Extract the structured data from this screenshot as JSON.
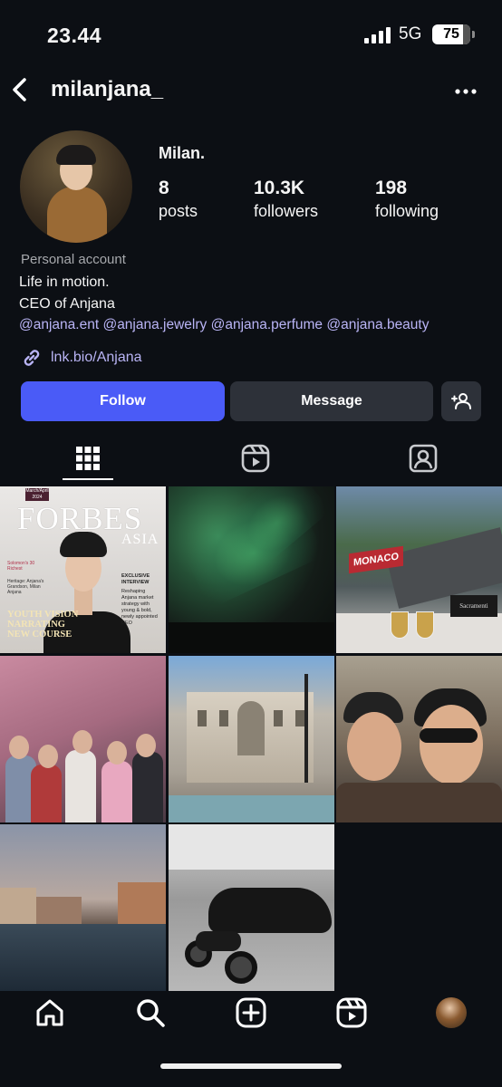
{
  "status_bar": {
    "time": "23.44",
    "network": "5G",
    "battery": "75"
  },
  "header": {
    "username": "milanjana_"
  },
  "profile": {
    "display_name": "Milan.",
    "stats": [
      {
        "value": "8",
        "label": "posts"
      },
      {
        "value": "10.3K",
        "label": "followers"
      },
      {
        "value": "198",
        "label": "following"
      }
    ],
    "account_type": "Personal account",
    "bio_lines": [
      "Life in motion.",
      "CEO of Anjana"
    ],
    "mentions": [
      "@anjana.ent",
      "@anjana.jewelry",
      "@anjana.perfume",
      "@anjana.beauty"
    ],
    "link": "lnk.bio/Anjana"
  },
  "actions": {
    "follow": "Follow",
    "message": "Message"
  },
  "tabs": [
    {
      "icon": "grid-icon",
      "active": true
    },
    {
      "icon": "reels-icon",
      "active": false
    },
    {
      "icon": "tagged-icon",
      "active": false
    }
  ],
  "posts": [
    {
      "type": "magazine-cover",
      "masthead": "FORBES",
      "region": "ASIA",
      "issue": "March/April 2024",
      "headline_lines": [
        "YOUTH VISION",
        "NARRATING",
        "NEW COURSE"
      ],
      "side_note": "Solomon's 30 Richest",
      "side_caption": "Heritage: Anjana's Grandson, Milan Anjana",
      "exclusive": "EXCLUSIVE INTERVIEW",
      "exclusive_text": "Reshaping Anjana market strategy with young & bold, newly appointed CEO"
    },
    {
      "type": "aurora-night"
    },
    {
      "type": "monaco-grandstand",
      "banner": "MONACO",
      "sign": "Sacramenti"
    },
    {
      "type": "group-photo"
    },
    {
      "type": "trevi-fountain"
    },
    {
      "type": "selfie"
    },
    {
      "type": "venice-canal"
    },
    {
      "type": "garage-car"
    }
  ],
  "bottom_nav": [
    "home-icon",
    "search-icon",
    "create-icon",
    "reels-icon",
    "profile-avatar"
  ]
}
